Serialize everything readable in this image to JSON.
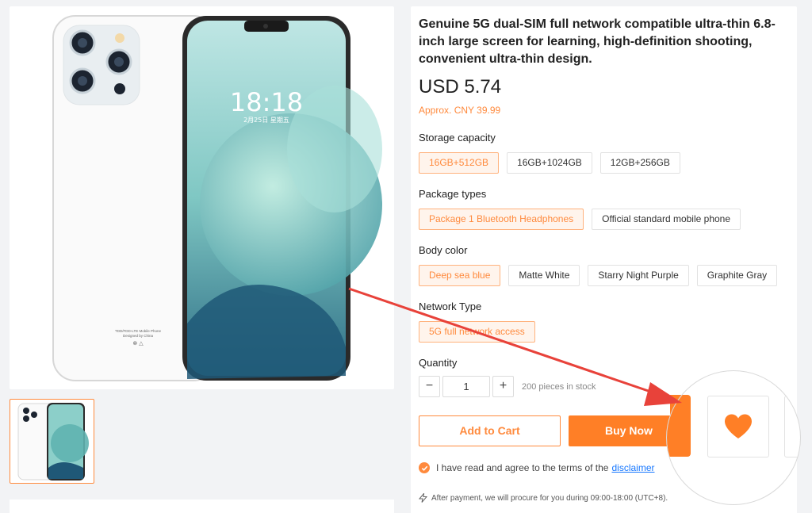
{
  "product": {
    "title": "Genuine 5G dual-SIM full network compatible ultra-thin 6.8-inch large screen for learning, high-definition shooting, convenient ultra-thin design.",
    "price": "USD 5.74",
    "approx_price": "Approx. CNY 39.99",
    "phone_screen": {
      "time": "18:18",
      "date": "2月25日 星期五"
    },
    "phone_back_text": [
      "TDD/FDD-LTE Mobile Phone",
      "Designed by China"
    ]
  },
  "options": [
    {
      "label": "Storage capacity",
      "values": [
        "16GB+512GB",
        "16GB+1024GB",
        "12GB+256GB"
      ],
      "selected": 0
    },
    {
      "label": "Package types",
      "values": [
        "Package 1 Bluetooth Headphones",
        "Official standard mobile phone"
      ],
      "selected": 0
    },
    {
      "label": "Body color",
      "values": [
        "Deep sea blue",
        "Matte White",
        "Starry Night Purple",
        "Graphite Gray"
      ],
      "selected": 0
    },
    {
      "label": "Network Type",
      "values": [
        "5G full network access"
      ],
      "selected": 0
    }
  ],
  "quantity": {
    "label": "Quantity",
    "minus": "−",
    "value": "1",
    "plus": "+",
    "stock": "200 pieces in stock"
  },
  "actions": {
    "add_to_cart": "Add to Cart",
    "buy_now": "Buy Now",
    "favorite_icon": "heart-icon"
  },
  "agreement": {
    "text": "I have read and agree to the terms of the",
    "link": "disclaimer"
  },
  "note": "After payment, we will procure for you during 09:00-18:00 (UTC+8).",
  "colors": {
    "accent": "#ff8a3d",
    "accent_dark": "#ff7f26",
    "arrow": "#e8423a",
    "link": "#1677ff"
  }
}
